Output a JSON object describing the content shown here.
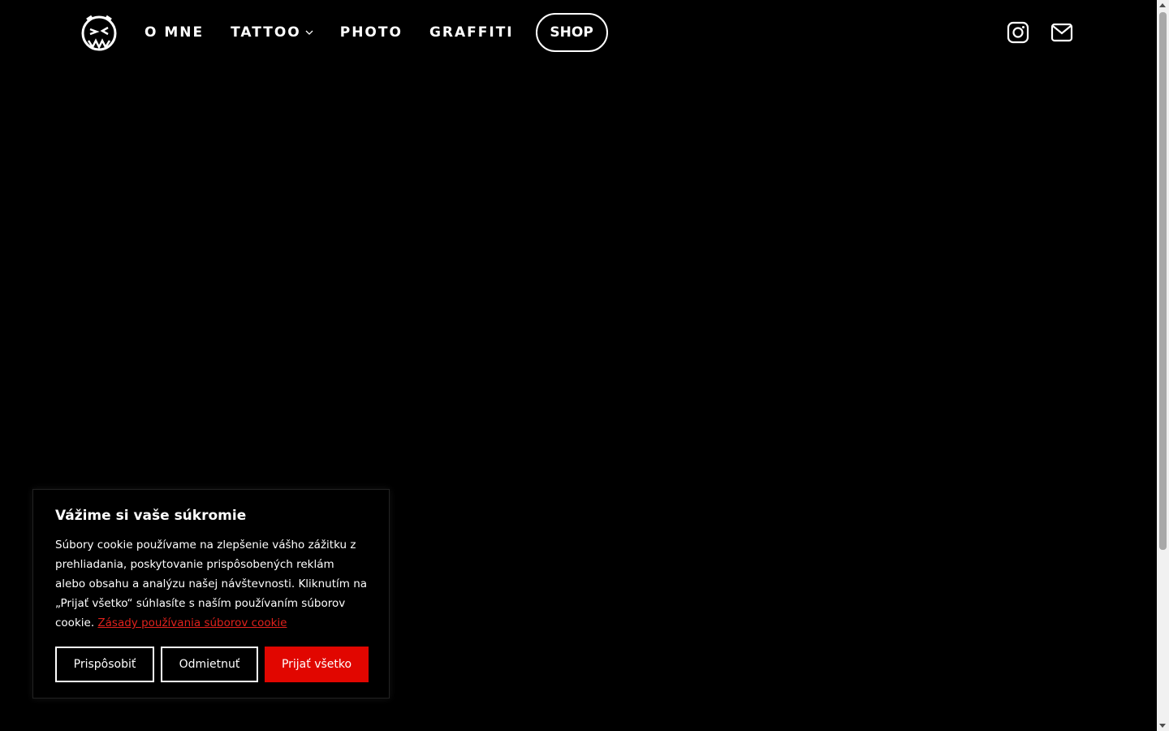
{
  "nav": {
    "items": [
      {
        "label": "O MNE"
      },
      {
        "label": "TATTOO",
        "has_dropdown": true
      },
      {
        "label": "PHOTO"
      },
      {
        "label": "GRAFFITI"
      }
    ],
    "shop_label": "SHOP"
  },
  "social": {
    "icons": [
      "instagram-icon",
      "mail-icon"
    ]
  },
  "cookie": {
    "title": "Vážime si vaše súkromie",
    "text": "Súbory cookie používame na zlepšenie vášho zážitku z prehliadania, poskytovanie prispôsobených reklám alebo obsahu a analýzu našej návštevnosti. Kliknutím na „Prijať všetko“ súhlasíte s naším používaním súborov cookie.",
    "link_label": "Zásady používania súborov cookie",
    "buttons": {
      "customize": "Prispôsobiť",
      "reject": "Odmietnuť",
      "accept": "Prijať všetko"
    }
  },
  "colors": {
    "background": "#000000",
    "accent": "#e10600",
    "link": "#e0211c"
  }
}
